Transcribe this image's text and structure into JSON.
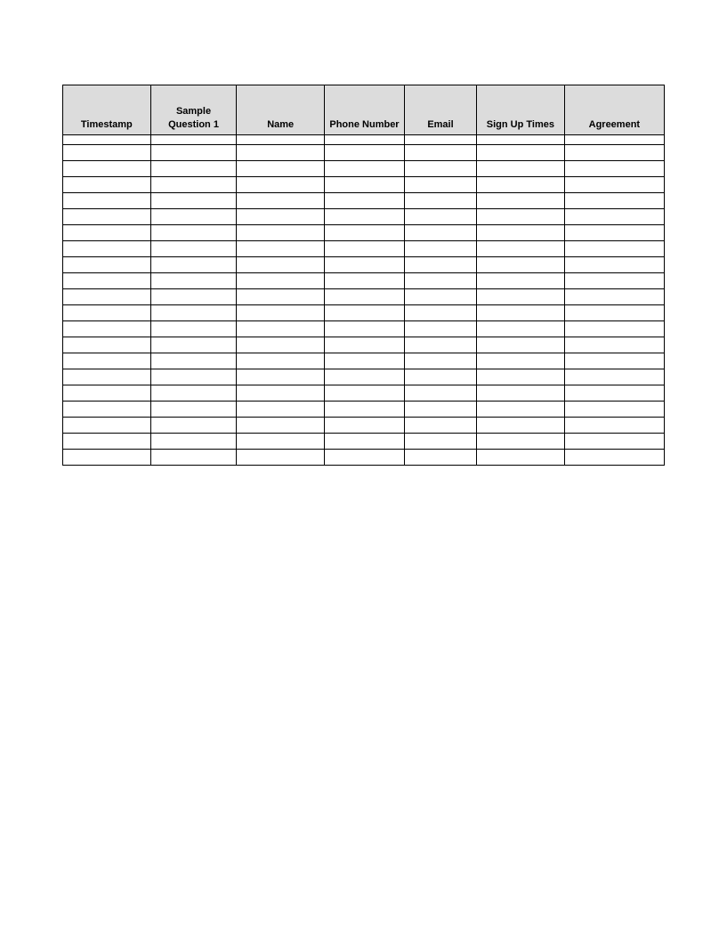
{
  "table": {
    "headers": [
      "Timestamp",
      "Sample Question 1",
      "Name",
      "Phone Number",
      "Email",
      "Sign Up Times",
      "Agreement"
    ],
    "rows": [
      [
        "",
        "",
        "",
        "",
        "",
        "",
        ""
      ],
      [
        "",
        "",
        "",
        "",
        "",
        "",
        ""
      ],
      [
        "",
        "",
        "",
        "",
        "",
        "",
        ""
      ],
      [
        "",
        "",
        "",
        "",
        "",
        "",
        ""
      ],
      [
        "",
        "",
        "",
        "",
        "",
        "",
        ""
      ],
      [
        "",
        "",
        "",
        "",
        "",
        "",
        ""
      ],
      [
        "",
        "",
        "",
        "",
        "",
        "",
        ""
      ],
      [
        "",
        "",
        "",
        "",
        "",
        "",
        ""
      ],
      [
        "",
        "",
        "",
        "",
        "",
        "",
        ""
      ],
      [
        "",
        "",
        "",
        "",
        "",
        "",
        ""
      ],
      [
        "",
        "",
        "",
        "",
        "",
        "",
        ""
      ],
      [
        "",
        "",
        "",
        "",
        "",
        "",
        ""
      ],
      [
        "",
        "",
        "",
        "",
        "",
        "",
        ""
      ],
      [
        "",
        "",
        "",
        "",
        "",
        "",
        ""
      ],
      [
        "",
        "",
        "",
        "",
        "",
        "",
        ""
      ],
      [
        "",
        "",
        "",
        "",
        "",
        "",
        ""
      ],
      [
        "",
        "",
        "",
        "",
        "",
        "",
        ""
      ],
      [
        "",
        "",
        "",
        "",
        "",
        "",
        ""
      ],
      [
        "",
        "",
        "",
        "",
        "",
        "",
        ""
      ],
      [
        "",
        "",
        "",
        "",
        "",
        "",
        ""
      ],
      [
        "",
        "",
        "",
        "",
        "",
        "",
        ""
      ]
    ]
  }
}
